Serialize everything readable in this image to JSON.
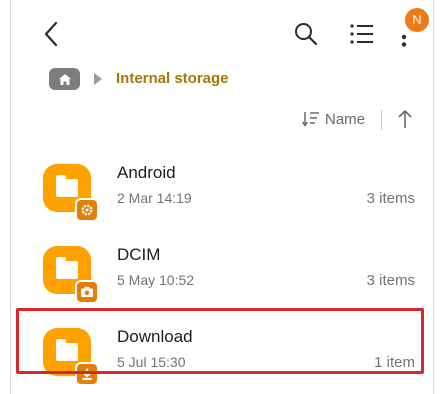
{
  "topbar": {
    "back_icon": "chevron-left-icon",
    "search_icon": "search-icon",
    "list_icon": "list-view-icon",
    "more_icon": "more-vertical-icon",
    "notification_badge": "N"
  },
  "breadcrumb": {
    "home_icon": "home-icon",
    "separator_icon": "caret-right-icon",
    "current": "Internal storage"
  },
  "sort": {
    "label": "Name",
    "sort_icon": "sort-lines-icon",
    "direction_icon": "arrow-up-icon"
  },
  "folders": [
    {
      "name": "Android",
      "date": "2 Mar 14:19",
      "count": "3 items",
      "badge_icon": "settings-gear-icon"
    },
    {
      "name": "DCIM",
      "date": "5 May 10:52",
      "count": "3 items",
      "badge_icon": "camera-icon"
    },
    {
      "name": "Download",
      "date": "5 Jul 15:30",
      "count": "1 item",
      "badge_icon": "download-arrow-icon"
    }
  ],
  "colors": {
    "folder": "#ffa200",
    "folder_badge": "#e27f0b",
    "breadcrumb_text": "#a87608",
    "notification": "#f07a1a",
    "highlight": "#d6262f"
  }
}
